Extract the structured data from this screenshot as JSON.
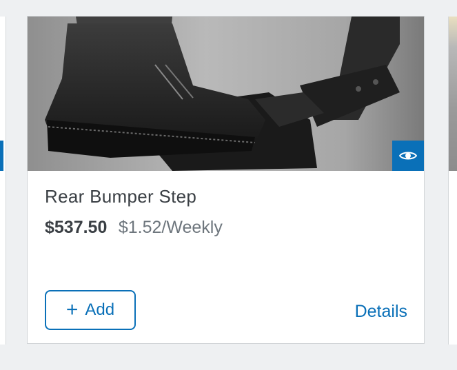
{
  "product": {
    "title": "Rear Bumper Step",
    "price": "$537.50",
    "weekly_price": "$1.52/Weekly",
    "image_alt": "Boot stepping on rear bumper step",
    "quick_view_icon": "eye-icon"
  },
  "actions": {
    "add_icon": "plus-icon",
    "add_label": "Add",
    "details_label": "Details"
  },
  "colors": {
    "accent": "#0a70b8",
    "text_primary": "#3a3f44",
    "text_secondary": "#6e767d",
    "background": "#eef0f2"
  }
}
